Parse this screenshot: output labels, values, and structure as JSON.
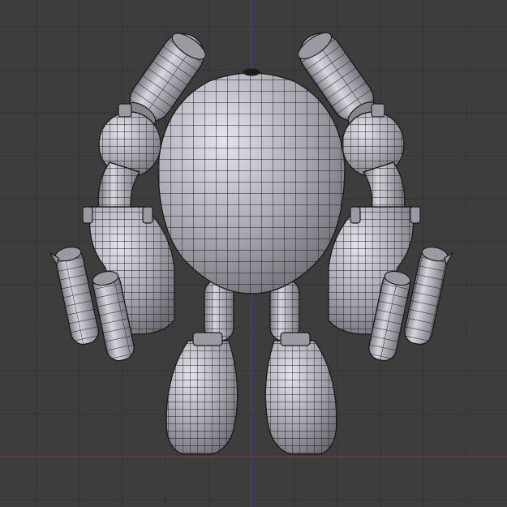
{
  "viewport": {
    "view": "front-orthographic",
    "shading": "solid-with-wireframe",
    "grid": true,
    "colors": {
      "background": "#3d3d3d",
      "grid_line": "#343434",
      "x_axis": "#8d3434",
      "z_axis": "#3f3fa6",
      "mesh_fill": "#a8a8b2",
      "mesh_wire": "#1c1c1c"
    }
  },
  "model": {
    "object_type": "mesh",
    "parts": [
      "head-left-cylinder",
      "head-right-cylinder",
      "torso",
      "left-shoulder",
      "right-shoulder",
      "left-upper-arm",
      "right-upper-arm",
      "left-forearm-canister",
      "right-forearm-canister",
      "left-claw-cylinders",
      "right-claw-cylinders",
      "left-leg",
      "right-leg",
      "left-foot",
      "right-foot"
    ]
  }
}
